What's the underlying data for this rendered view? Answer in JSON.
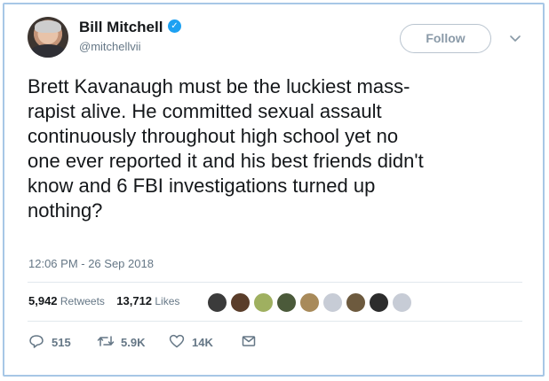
{
  "author": {
    "name": "Bill Mitchell",
    "handle": "@mitchellvii",
    "verified_badge": "✓",
    "avatar_icon": "profile-photo"
  },
  "follow_button": {
    "label": "Follow"
  },
  "menu_icon": "chevron-down-icon",
  "tweet": {
    "lines": [
      "Brett Kavanaugh must be the luckiest mass-",
      "rapist alive.  He committed sexual assault",
      "continuously throughout high school yet no",
      "one ever reported it and his best friends didn't",
      "know and 6 FBI investigations turned up",
      "nothing?"
    ],
    "timestamp": "12:06 PM - 26 Sep 2018"
  },
  "stats": {
    "retweets_count": "5,942",
    "retweets_label": "Retweets",
    "likes_count": "13,712",
    "likes_label": "Likes"
  },
  "likers_faces": [
    "#3b3b3b",
    "#5a3d2a",
    "#9fb060",
    "#4b5a3a",
    "#a88a5a",
    "#c7ccd6",
    "#6d5a3e",
    "#2c2c2c",
    "#c7ccd6"
  ],
  "actions": {
    "reply_count": "515",
    "retweet_count": "5.9K",
    "like_count": "14K"
  },
  "colors": {
    "accent": "#1da1f2",
    "muted_text": "#657786",
    "frame_border": "#a7c7e6"
  }
}
